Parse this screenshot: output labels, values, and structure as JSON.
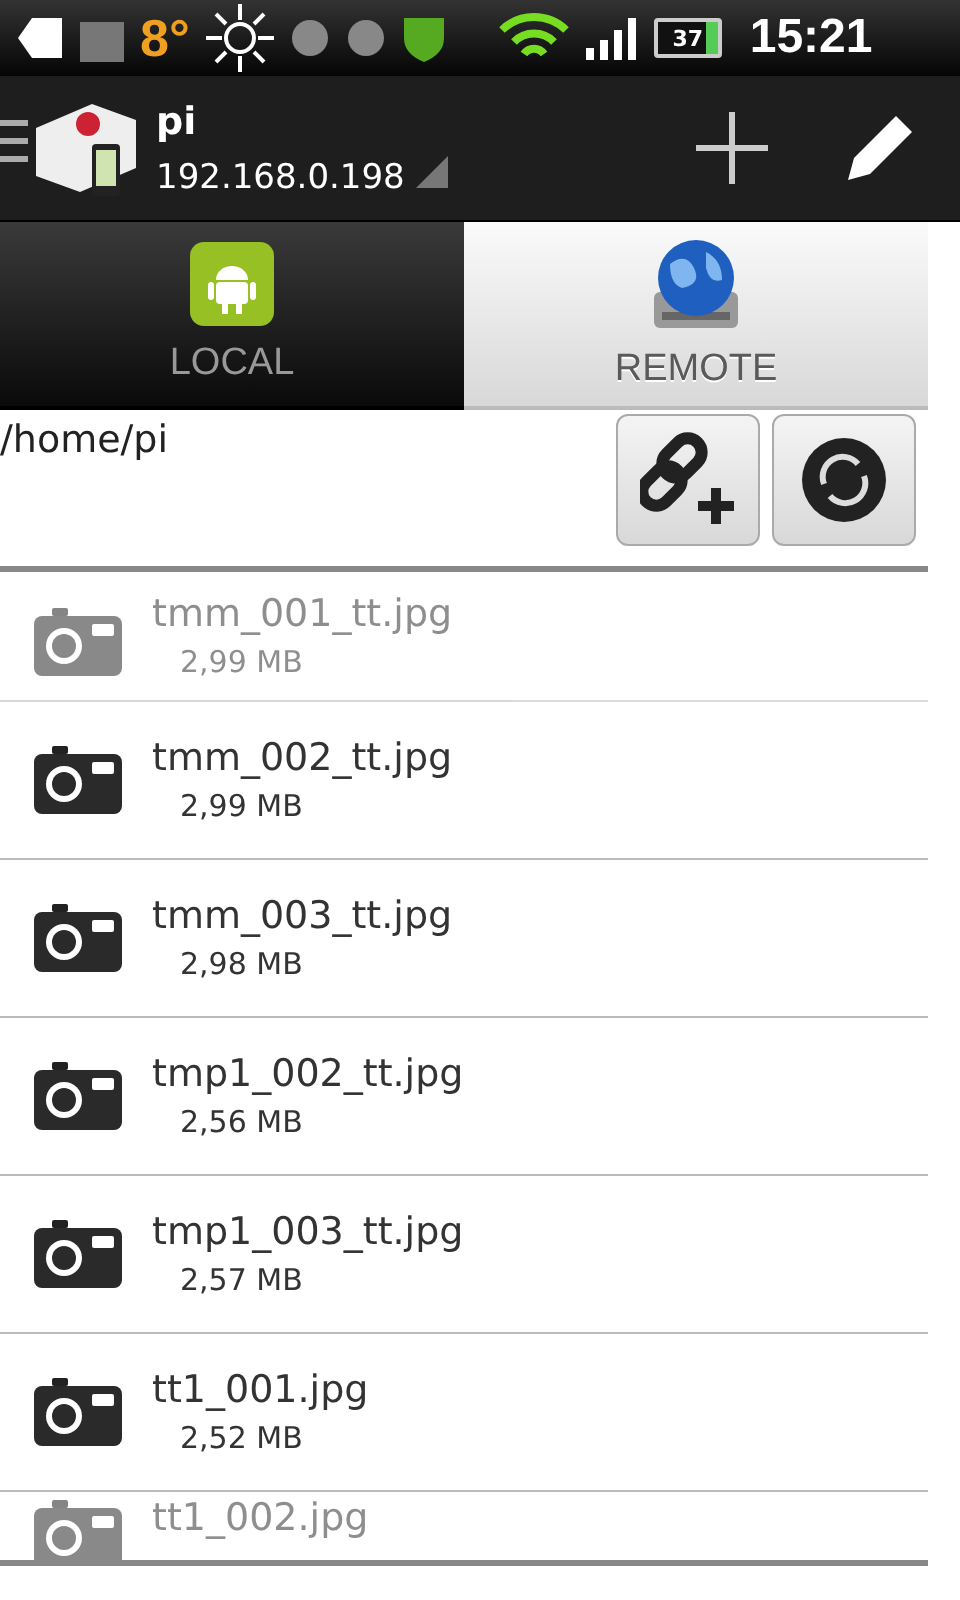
{
  "status_bar": {
    "temperature": "8°",
    "battery": "37",
    "time": "15:21"
  },
  "app_bar": {
    "title": "pi",
    "subtitle": "192.168.0.198"
  },
  "tabs": [
    {
      "label": "LOCAL",
      "selected": false,
      "kind": "android"
    },
    {
      "label": "REMOTE",
      "selected": true,
      "kind": "globe"
    }
  ],
  "path": "/home/pi",
  "files": [
    {
      "name": "tmm_001_tt.jpg",
      "size": "2,99 MB"
    },
    {
      "name": "tmm_002_tt.jpg",
      "size": "2,99 MB"
    },
    {
      "name": "tmm_003_tt.jpg",
      "size": "2,98 MB"
    },
    {
      "name": "tmp1_002_tt.jpg",
      "size": "2,56 MB"
    },
    {
      "name": "tmp1_003_tt.jpg",
      "size": "2,57 MB"
    },
    {
      "name": "tt1_001.jpg",
      "size": "2,52 MB"
    },
    {
      "name": "tt1_002.jpg"
    }
  ]
}
